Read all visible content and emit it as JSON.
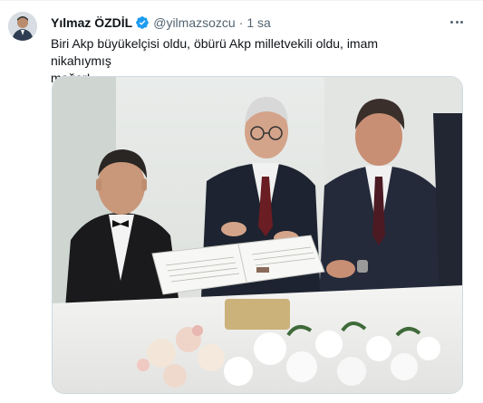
{
  "tweet": {
    "display_name": "Yılmaz ÖZDİL",
    "handle": "@yilmazsozcu",
    "separator": "·",
    "time": "1 sa",
    "text_line1": "Biri Akp büyükelçisi oldu, öbürü Akp milletvekili oldu, imam nikahıymış",
    "text_line2": "meğer!"
  },
  "icons": {
    "verified": "verified-badge-icon",
    "more": "more-options-icon"
  },
  "colors": {
    "verified_blue": "#1d9bf0",
    "primary_text": "#0f1419",
    "secondary_text": "#536471",
    "border": "#cfd9de"
  }
}
